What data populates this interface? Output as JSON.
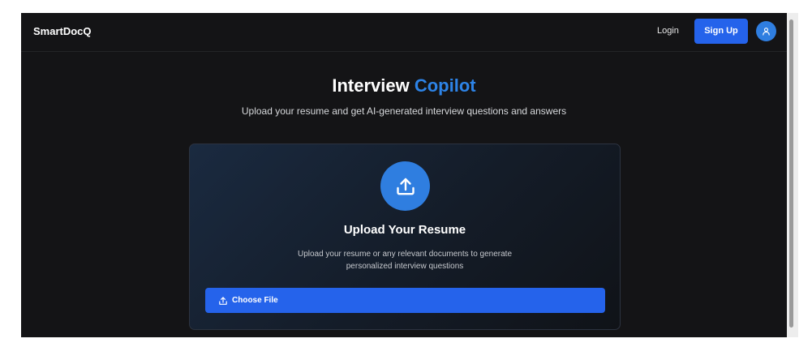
{
  "navbar": {
    "brand": "SmartDocQ",
    "login_label": "Login",
    "signup_label": "Sign Up",
    "avatar_icon": "user-icon"
  },
  "hero": {
    "title_main": "Interview",
    "title_accent": "Copilot",
    "subtitle": "Upload your resume and get AI-generated interview questions and answers"
  },
  "upload_card": {
    "icon": "upload-icon",
    "title": "Upload Your Resume",
    "description_line1": "Upload your resume or any relevant documents to generate",
    "description_line2": "personalized interview questions",
    "button_icon": "upload-small-icon",
    "button_label": "Choose File"
  },
  "colors": {
    "background": "#141416",
    "accent": "#2563eb",
    "title_accent": "#2d83e6",
    "icon_circle": "#2f7ee0"
  }
}
